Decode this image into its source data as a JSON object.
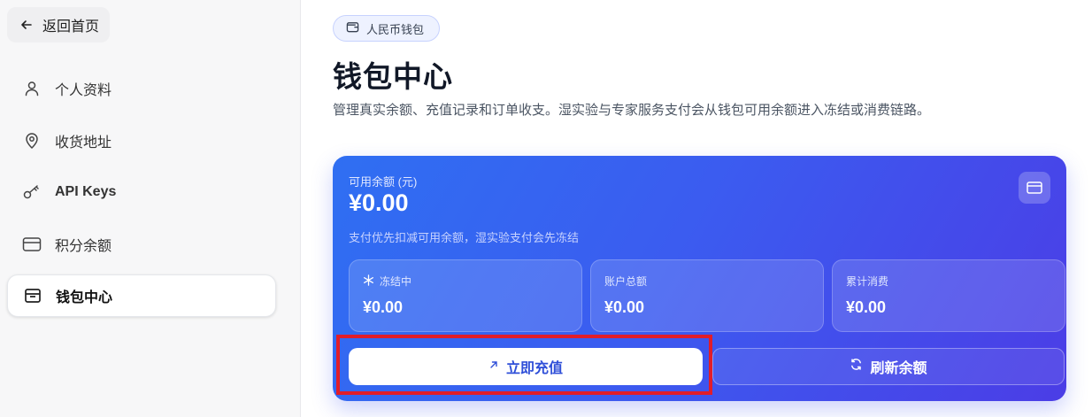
{
  "sidebar": {
    "back_label": "返回首页",
    "items": [
      {
        "label": "个人资料",
        "icon": "user-icon"
      },
      {
        "label": "收货地址",
        "icon": "map-pin-icon"
      },
      {
        "label": "API Keys",
        "icon": "key-icon"
      },
      {
        "label": "积分余额",
        "icon": "credit-card-icon"
      },
      {
        "label": "钱包中心",
        "icon": "wallet-icon",
        "active": true
      }
    ]
  },
  "header": {
    "badge": "人民币钱包",
    "title": "钱包中心",
    "description": "管理真实余额、充值记录和订单收支。湿实验与专家服务支付会从钱包可用余额进入冻结或消费链路。"
  },
  "wallet": {
    "available_label": "可用余额 (元)",
    "available_value": "¥0.00",
    "note": "支付优先扣减可用余额，湿实验支付会先冻结",
    "stats": [
      {
        "label": "冻结中",
        "value": "¥0.00",
        "icon": "snowflake-icon"
      },
      {
        "label": "账户总额",
        "value": "¥0.00"
      },
      {
        "label": "累计消费",
        "value": "¥0.00"
      }
    ],
    "recharge_label": "立即充值",
    "refresh_label": "刷新余额"
  },
  "colors": {
    "accent": "#2f6ff2",
    "card_gradient_end": "#4b3de6",
    "highlight": "#e11d2a"
  }
}
